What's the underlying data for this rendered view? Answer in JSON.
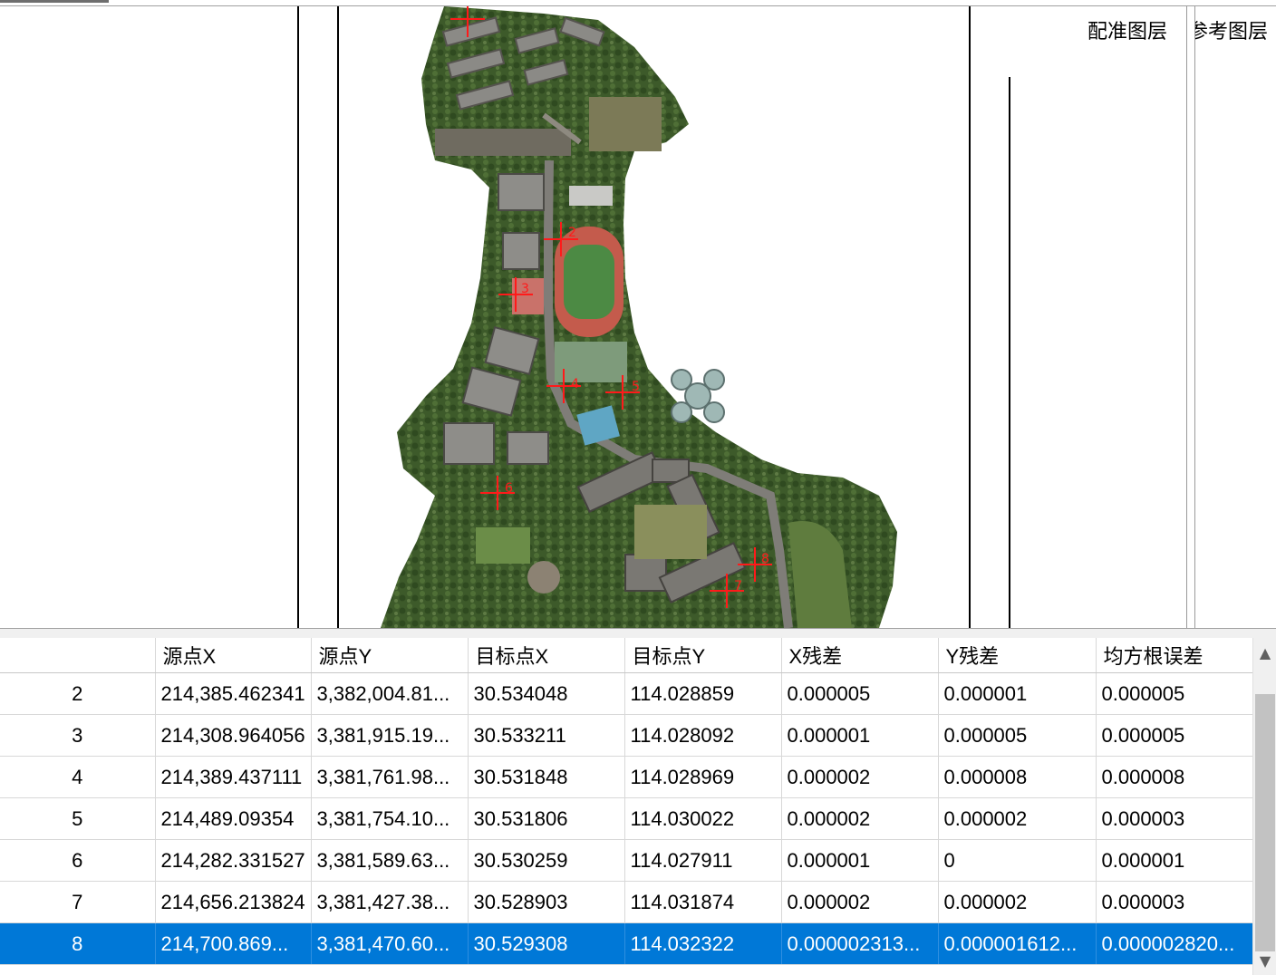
{
  "map": {
    "reference_layer_title": "配准图层",
    "target_layer_title": "参考图层",
    "control_points": [
      "2",
      "3",
      "4",
      "5",
      "6",
      "7",
      "8"
    ],
    "marker_color": "#ff1a1a"
  },
  "table": {
    "columns": [
      "",
      "源点X",
      "源点Y",
      "目标点X",
      "目标点Y",
      "X残差",
      "Y残差",
      "均方根误差"
    ],
    "rows": [
      {
        "id": "2",
        "src_x": "214,385.462341",
        "src_y": "3,382,004.81...",
        "dst_x": "30.534048",
        "dst_y": "114.028859",
        "res_x": "0.000005",
        "res_y": "0.000001",
        "rmse": "0.000005"
      },
      {
        "id": "3",
        "src_x": "214,308.964056",
        "src_y": "3,381,915.19...",
        "dst_x": "30.533211",
        "dst_y": "114.028092",
        "res_x": "0.000001",
        "res_y": "0.000005",
        "rmse": "0.000005"
      },
      {
        "id": "4",
        "src_x": "214,389.437111",
        "src_y": "3,381,761.98...",
        "dst_x": "30.531848",
        "dst_y": "114.028969",
        "res_x": "0.000002",
        "res_y": "0.000008",
        "rmse": "0.000008"
      },
      {
        "id": "5",
        "src_x": "214,489.09354",
        "src_y": "3,381,754.10...",
        "dst_x": "30.531806",
        "dst_y": "114.030022",
        "res_x": "0.000002",
        "res_y": "0.000002",
        "rmse": "0.000003"
      },
      {
        "id": "6",
        "src_x": "214,282.331527",
        "src_y": "3,381,589.63...",
        "dst_x": "30.530259",
        "dst_y": "114.027911",
        "res_x": "0.000001",
        "res_y": "0",
        "rmse": "0.000001"
      },
      {
        "id": "7",
        "src_x": "214,656.213824",
        "src_y": "3,381,427.38...",
        "dst_x": "30.528903",
        "dst_y": "114.031874",
        "res_x": "0.000002",
        "res_y": "0.000002",
        "rmse": "0.000003"
      },
      {
        "id": "8",
        "src_x": "214,700.869...",
        "src_y": "3,381,470.60...",
        "dst_x": "30.529308",
        "dst_y": "114.032322",
        "res_x": "0.000002313...",
        "res_y": "0.000001612...",
        "rmse": "0.000002820...",
        "selected": true
      }
    ]
  },
  "colors": {
    "selection": "#0078d7",
    "marker": "#ff1a1a"
  }
}
